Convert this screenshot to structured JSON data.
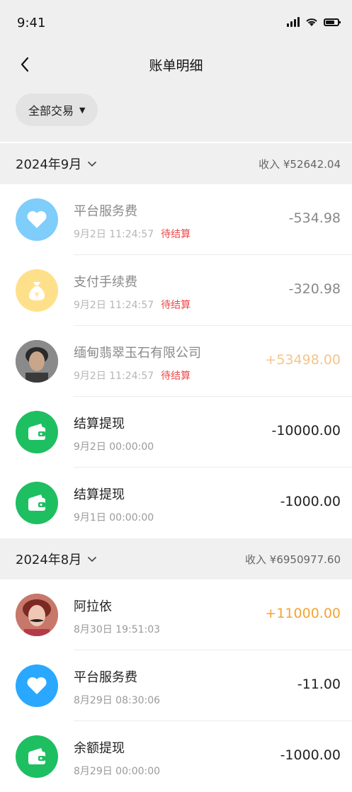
{
  "status_bar": {
    "time": "9:41"
  },
  "nav": {
    "title": "账单明细"
  },
  "filter": {
    "label": "全部交易"
  },
  "colors": {
    "pending_text": "#f04848",
    "income_amount": "#f5a431",
    "wallet_green": "#1ebf61",
    "platform_blue": "#2aa8ff",
    "fee_yellow": "#ffd863"
  },
  "months": [
    {
      "label": "2024年9月",
      "summary": "收入 ¥52642.04",
      "items": [
        {
          "title": "平台服务费",
          "date": "9月2日 11:24:57",
          "status": "待结算",
          "amount": "-534.98",
          "icon": "heart-icon"
        },
        {
          "title": "支付手续费",
          "date": "9月2日 11:24:57",
          "status": "待结算",
          "amount": "-320.98",
          "icon": "money-bag-icon"
        },
        {
          "title": "缅甸翡翠玉石有限公司",
          "date": "9月2日 11:24:57",
          "status": "待结算",
          "amount": "+53498.00",
          "icon": "user-avatar"
        },
        {
          "title": "结算提现",
          "date": "9月2日 00:00:00",
          "status": "",
          "amount": "-10000.00",
          "icon": "wallet-icon"
        },
        {
          "title": "结算提现",
          "date": "9月1日 00:00:00",
          "status": "",
          "amount": "-1000.00",
          "icon": "wallet-icon"
        }
      ]
    },
    {
      "label": "2024年8月",
      "summary": "收入 ¥6950977.60",
      "items": [
        {
          "title": "阿拉依",
          "date": "8月30日 19:51:03",
          "status": "",
          "amount": "+11000.00",
          "icon": "user-avatar"
        },
        {
          "title": "平台服务费",
          "date": "8月29日 08:30:06",
          "status": "",
          "amount": "-11.00",
          "icon": "heart-icon"
        },
        {
          "title": "余额提现",
          "date": "8月29日 00:00:00",
          "status": "",
          "amount": "-1000.00",
          "icon": "wallet-icon"
        }
      ]
    }
  ]
}
